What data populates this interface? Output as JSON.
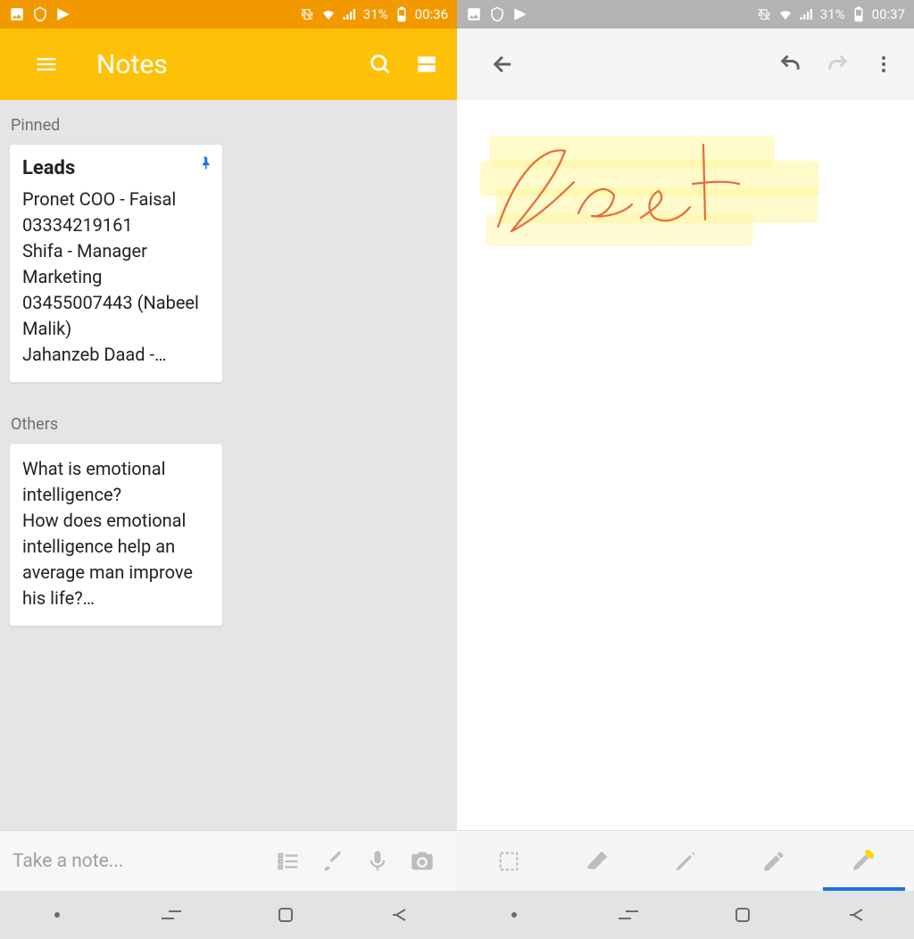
{
  "left": {
    "status": {
      "battery_pct": "31%",
      "time": "00:36"
    },
    "appbar": {
      "title": "Notes"
    },
    "sections": {
      "pinned_label": "Pinned",
      "others_label": "Others"
    },
    "notes": {
      "pinned": {
        "title": "Leads",
        "body": "Pronet COO - Faisal 03334219161\nShifa - Manager Marketing 03455007443 (Nabeel Malik)\nJahanzeb Daad -…"
      },
      "others": {
        "body": "What is emotional intelligence?\nHow does emotional intelligence help an average man improve his life?…"
      }
    },
    "bottom": {
      "placeholder": "Take a note..."
    }
  },
  "right": {
    "status": {
      "battery_pct": "31%",
      "time": "00:37"
    },
    "canvas": {
      "handwriting_text": "Test"
    },
    "toolbar": {
      "select": "select-tool",
      "eraser": "eraser-tool",
      "pen": "pen-tool",
      "pencil": "pencil-tool",
      "highlighter": "highlighter-tool",
      "active_index": 4
    }
  },
  "colors": {
    "accent_orange": "#ffc107",
    "status_orange": "#f29900",
    "highlighter": "#fff59d",
    "ink": "#e96a3a",
    "blue": "#1a73e8"
  }
}
